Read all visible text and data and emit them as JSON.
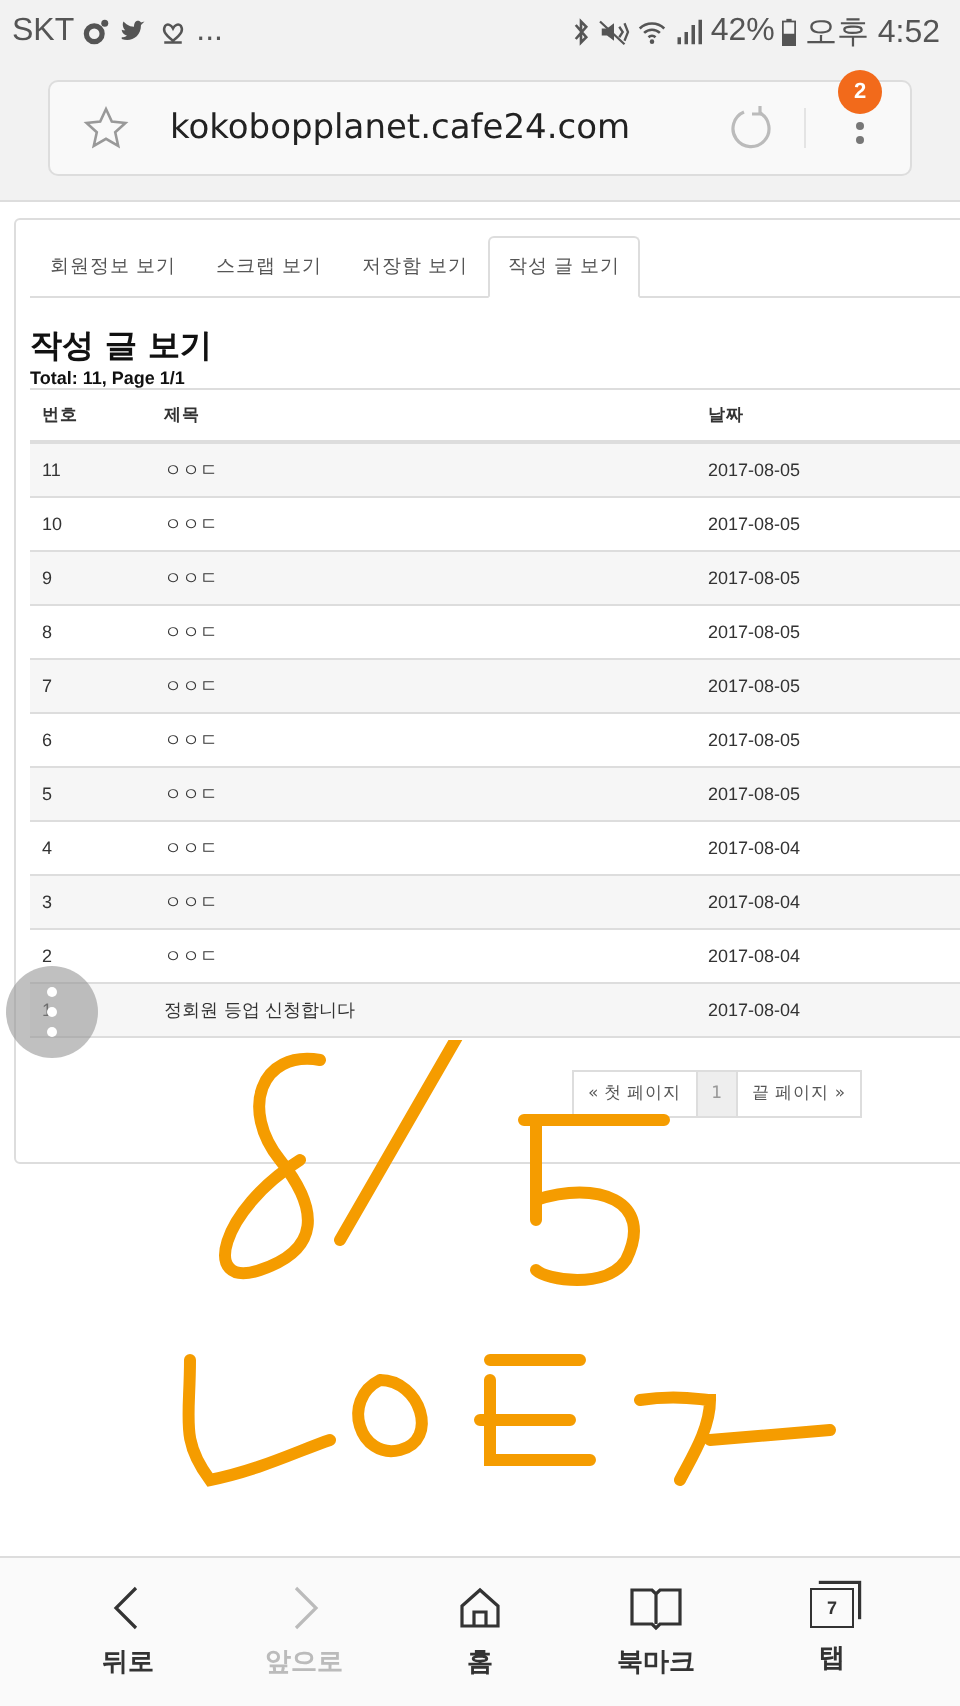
{
  "status_bar": {
    "carrier": "SKT",
    "notification_more": "...",
    "battery": "42%",
    "time": "오후 4:52"
  },
  "address_bar": {
    "url": "kokobopplanet.cafe24.com",
    "badge": "2"
  },
  "tabs": [
    {
      "label": "회원정보 보기",
      "selected": false
    },
    {
      "label": "스크랩 보기",
      "selected": false
    },
    {
      "label": "저장함 보기",
      "selected": false
    },
    {
      "label": "작성 글 보기",
      "selected": true
    }
  ],
  "heading": "작성 글 보기",
  "summary": "Total: 11, Page 1/1",
  "table": {
    "columns": [
      "번호",
      "제목",
      "날짜"
    ],
    "rows": [
      [
        "11",
        "ㅇㅇㄷ",
        "2017-08-05"
      ],
      [
        "10",
        "ㅇㅇㄷ",
        "2017-08-05"
      ],
      [
        "9",
        "ㅇㅇㄷ",
        "2017-08-05"
      ],
      [
        "8",
        "ㅇㅇㄷ",
        "2017-08-05"
      ],
      [
        "7",
        "ㅇㅇㄷ",
        "2017-08-05"
      ],
      [
        "6",
        "ㅇㅇㄷ",
        "2017-08-05"
      ],
      [
        "5",
        "ㅇㅇㄷ",
        "2017-08-05"
      ],
      [
        "4",
        "ㅇㅇㄷ",
        "2017-08-04"
      ],
      [
        "3",
        "ㅇㅇㄷ",
        "2017-08-04"
      ],
      [
        "2",
        "ㅇㅇㄷ",
        "2017-08-04"
      ],
      [
        "1",
        "정회원 등업 신청합니다",
        "2017-08-04"
      ]
    ]
  },
  "pagination": [
    {
      "label": "« 첫 페이지",
      "selected": false
    },
    {
      "label": "1",
      "selected": true
    },
    {
      "label": "끝 페이지 »",
      "selected": false
    }
  ],
  "bottom_nav": [
    {
      "kind": "back",
      "label": "뒤로",
      "disabled": false
    },
    {
      "kind": "forward",
      "label": "앞으로",
      "disabled": true
    },
    {
      "kind": "home",
      "label": "홈",
      "disabled": false
    },
    {
      "kind": "bookmark",
      "label": "북마크",
      "disabled": false
    },
    {
      "kind": "tabs",
      "label": "탭",
      "count": "7",
      "disabled": false
    }
  ]
}
